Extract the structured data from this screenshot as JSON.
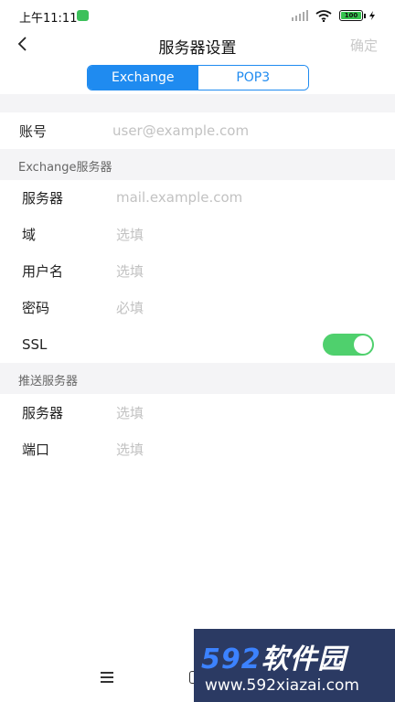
{
  "status_bar": {
    "time": "上午11:11",
    "battery": "100",
    "colors": {
      "app_dot": "#3cc05a",
      "battery_fill": "#35c34d"
    }
  },
  "nav": {
    "title": "服务器设置",
    "confirm_label": "确定"
  },
  "segment": {
    "tabs": [
      {
        "label": "Exchange",
        "active": true
      },
      {
        "label": "POP3",
        "active": false
      }
    ],
    "accent": "#1f8bf0"
  },
  "account": {
    "label": "账号",
    "placeholder": "user@example.com"
  },
  "exchange_section": {
    "title": "Exchange服务器",
    "rows": [
      {
        "label": "服务器",
        "placeholder": "mail.example.com"
      },
      {
        "label": "域",
        "placeholder": "选填"
      },
      {
        "label": "用户名",
        "placeholder": "选填"
      },
      {
        "label": "密码",
        "placeholder": "必填"
      }
    ],
    "ssl": {
      "label": "SSL",
      "enabled": true,
      "toggle_color": "#4fd06d"
    }
  },
  "push_section": {
    "title": "推送服务器",
    "rows": [
      {
        "label": "服务器",
        "placeholder": "选填"
      },
      {
        "label": "端口",
        "placeholder": "选填"
      }
    ]
  },
  "watermark": {
    "brand_num": "592",
    "brand_text": "软件园",
    "url": "www.592xiazai.com"
  }
}
